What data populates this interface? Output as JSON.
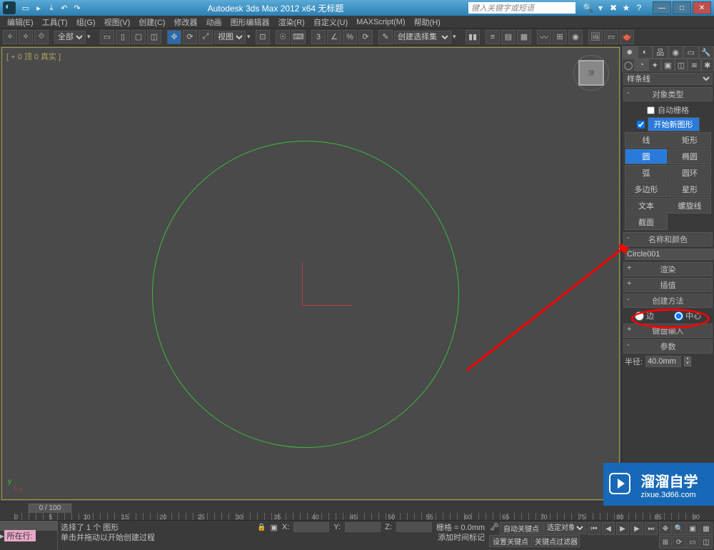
{
  "title": "Autodesk 3ds Max 2012 x64   无标题",
  "search_placeholder": "键入关键字或短语",
  "menus": [
    "编辑(E)",
    "工具(T)",
    "组(G)",
    "视图(V)",
    "创建(C)",
    "修改器",
    "动画",
    "图形编辑器",
    "渲染(R)",
    "自定义(U)",
    "MAXScript(M)",
    "帮助(H)"
  ],
  "toolbar": {
    "scope": "全部",
    "view_dd": "视图",
    "selset_dd": "创建选择集"
  },
  "viewport": {
    "label": "[ + 0 顶 0 真实 ]",
    "cube_face": "顶"
  },
  "panel": {
    "category": "样条线",
    "rollout_objtype": "对象类型",
    "autogrid": "自动栅格",
    "startshape": "开始新图形",
    "buttons": [
      "线",
      "矩形",
      "圆",
      "椭圆",
      "弧",
      "圆环",
      "多边形",
      "星形",
      "文本",
      "螺旋线",
      "截面"
    ],
    "active_btn": "圆",
    "rollout_name": "名称和颜色",
    "obj_name": "Circle001",
    "rollout_render": "渲染",
    "rollout_interp": "插值",
    "rollout_method": "创建方法",
    "method_edge": "边",
    "method_center": "中心",
    "rollout_kbd": "键盘输入",
    "rollout_params": "参数",
    "radius_label": "半径:",
    "radius_value": "40.0mm"
  },
  "timeline": {
    "slider": "0 / 100",
    "ticks": [
      "0",
      "5",
      "10",
      "15",
      "20",
      "25",
      "30",
      "35",
      "40",
      "45",
      "50",
      "55",
      "60",
      "65",
      "70",
      "75",
      "80",
      "85",
      "90"
    ]
  },
  "status": {
    "row_label": "所在行:",
    "sel": "选择了 1 个 图形",
    "prompt": "单击并拖动以开始创建过程",
    "grid": "栅格 = 0.0mm",
    "autokey": "自动关键点",
    "selfilter": "选定对象",
    "setkey": "设置关键点",
    "keyfilter": "关键点过滤器",
    "addtime": "添加时间标记"
  },
  "watermark": {
    "main": "溜溜自学",
    "sub": "zixue.3d66.com"
  }
}
